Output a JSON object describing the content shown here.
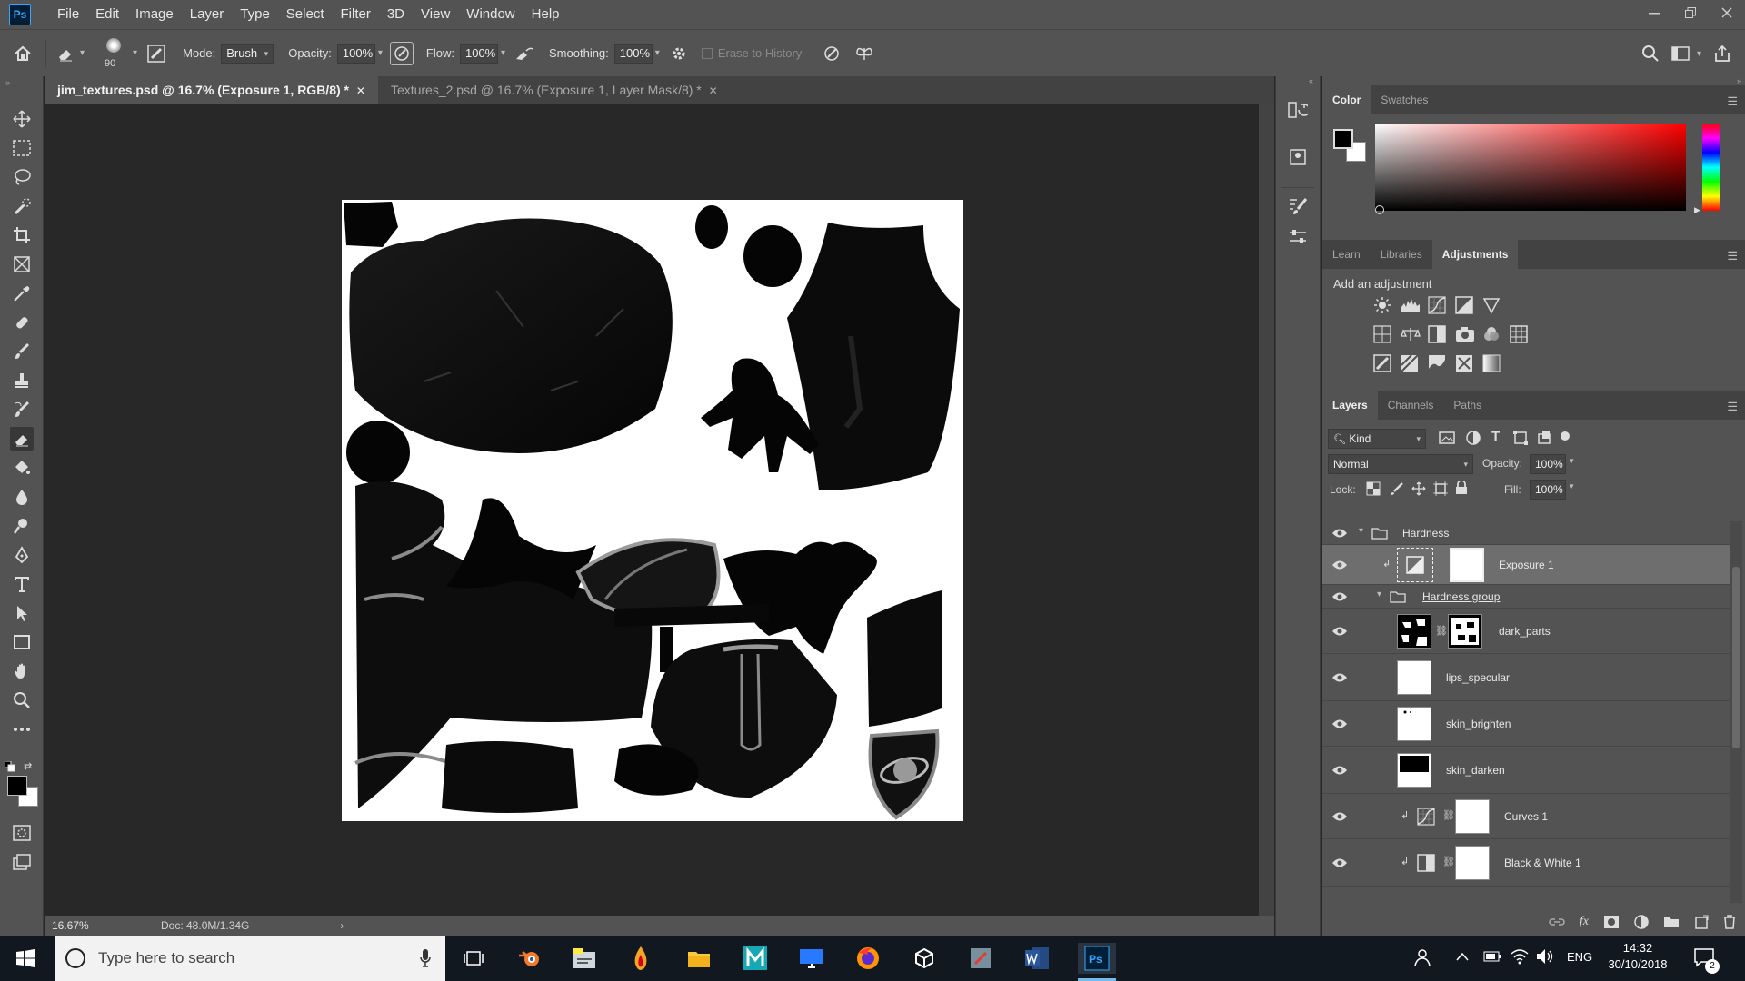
{
  "app": {
    "logo": "Ps"
  },
  "menu": [
    "File",
    "Edit",
    "Image",
    "Layer",
    "Type",
    "Select",
    "Filter",
    "3D",
    "View",
    "Window",
    "Help"
  ],
  "options": {
    "brush_size": "90",
    "mode_label": "Mode:",
    "mode_value": "Brush",
    "opacity_label": "Opacity:",
    "opacity_value": "100%",
    "flow_label": "Flow:",
    "flow_value": "100%",
    "smoothing_label": "Smoothing:",
    "smoothing_value": "100%",
    "erase_to_history": "Erase to History"
  },
  "tabs": [
    {
      "label": "jim_textures.psd @ 16.7% (Exposure 1, RGB/8) *",
      "active": true
    },
    {
      "label": "Textures_2.psd @ 16.7% (Exposure 1, Layer Mask/8) *",
      "active": false
    }
  ],
  "status": {
    "zoom": "16.67%",
    "doc": "Doc: 48.0M/1.34G"
  },
  "color_panel": {
    "tabs": [
      "Color",
      "Swatches"
    ],
    "active": "Color"
  },
  "adjust_panel": {
    "tabs": [
      "Learn",
      "Libraries",
      "Adjustments"
    ],
    "active": "Adjustments",
    "hint": "Add an adjustment"
  },
  "layers_panel": {
    "tabs": [
      "Layers",
      "Channels",
      "Paths"
    ],
    "active": "Layers",
    "filter": "Kind",
    "blend_mode": "Normal",
    "opacity_label": "Opacity:",
    "opacity_value": "100%",
    "lock_label": "Lock:",
    "fill_label": "Fill:",
    "fill_value": "100%",
    "layers": [
      {
        "name": "Hardness",
        "kind": "group"
      },
      {
        "name": "Exposure 1",
        "kind": "adjustment",
        "selected": true
      },
      {
        "name": "Hardness group",
        "kind": "group"
      },
      {
        "name": "dark_parts",
        "kind": "masked"
      },
      {
        "name": "lips_specular",
        "kind": "pixel"
      },
      {
        "name": "skin_brighten",
        "kind": "pixel"
      },
      {
        "name": "skin_darken",
        "kind": "pixel"
      },
      {
        "name": "Curves 1",
        "kind": "adjustment"
      },
      {
        "name": "Black & White 1",
        "kind": "adjustment"
      }
    ]
  },
  "taskbar": {
    "search_placeholder": "Type here to search",
    "lang": "ENG",
    "time": "14:32",
    "date": "30/10/2018",
    "notifications": "2"
  },
  "colors": {
    "accent": "#31a8ff",
    "panel": "#535353",
    "canvas_bg": "#282828"
  }
}
